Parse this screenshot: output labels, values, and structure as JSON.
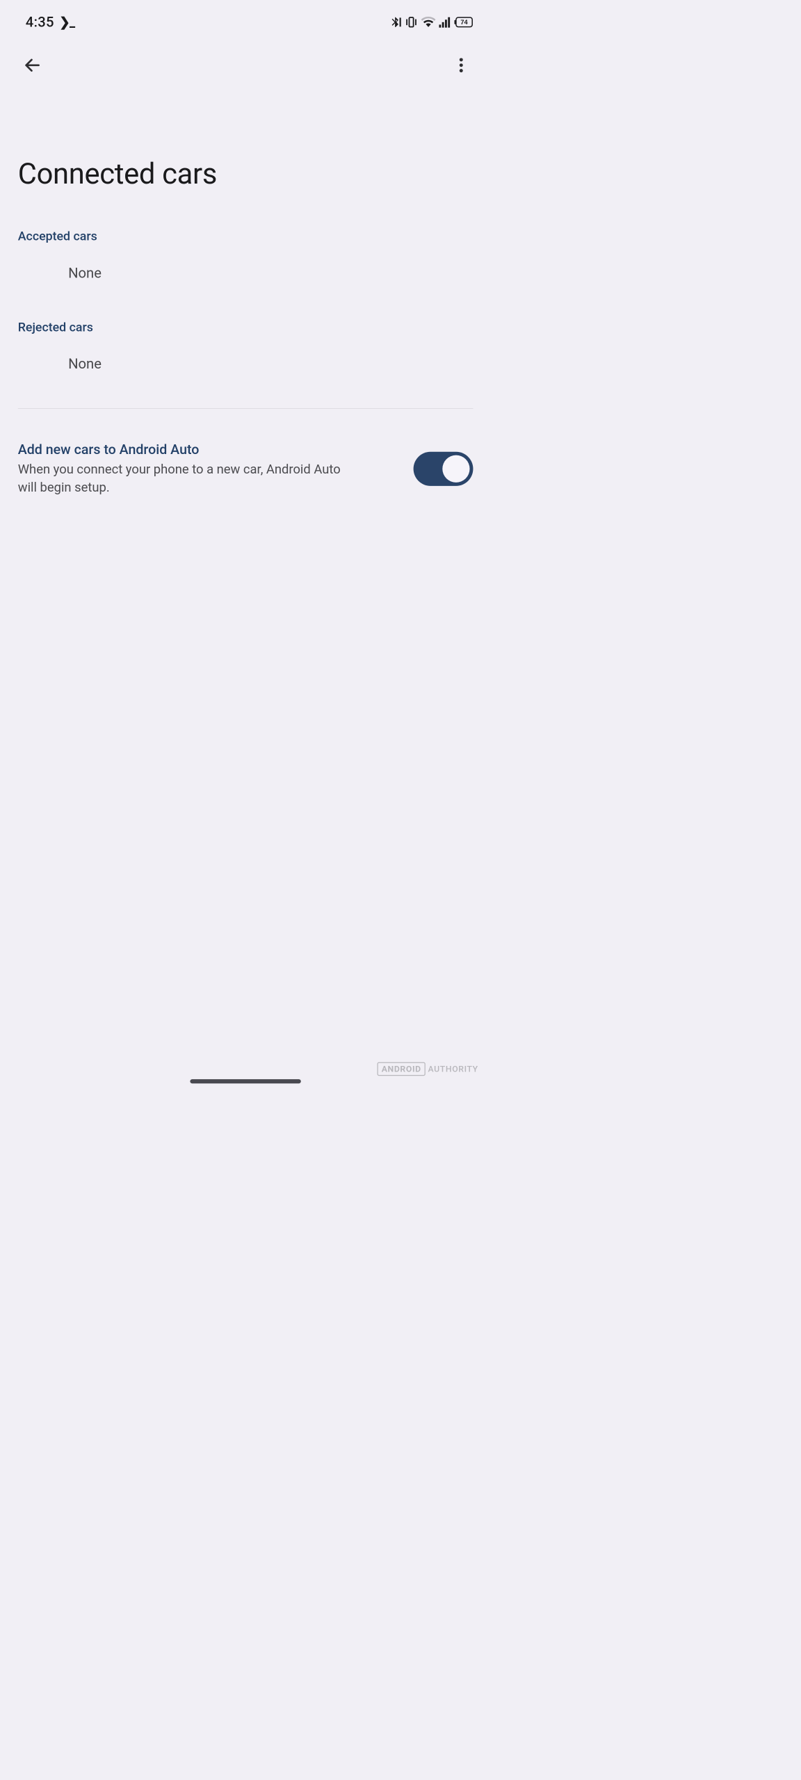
{
  "status": {
    "time": "4:35",
    "prompt": "❯_",
    "battery": "74"
  },
  "page": {
    "title": "Connected cars"
  },
  "sections": {
    "accepted": {
      "header": "Accepted cars",
      "value": "None"
    },
    "rejected": {
      "header": "Rejected cars",
      "value": "None"
    }
  },
  "setting": {
    "title": "Add new cars to Android Auto",
    "description": "When you connect your phone to a new car, Android Auto will begin setup.",
    "enabled": true
  },
  "watermark": {
    "brand": "ANDROID",
    "site": "AUTHORITY"
  }
}
